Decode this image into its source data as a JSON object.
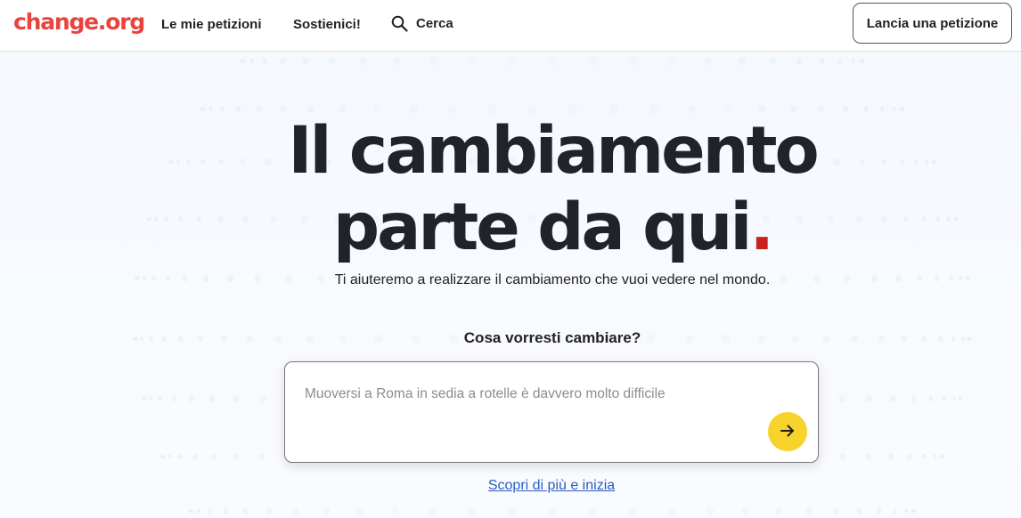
{
  "header": {
    "logo": "change.org",
    "nav": {
      "my_petitions": "Le mie petizioni",
      "support": "Sostienici!",
      "search": "Cerca"
    },
    "launch_button": "Lancia una petizione"
  },
  "hero": {
    "title_line1": "Il cambiamento",
    "title_line2": "parte da qui",
    "title_dot": ".",
    "subtitle": "Ti aiuteremo a realizzare il cambiamento che vuoi vedere nel mondo.",
    "question": "Cosa vorresti cambiare?",
    "input_placeholder": "Muoversi a Roma in sedia a rotelle è davvero molto difficile",
    "learn_more": "Scopri di più e inizia"
  },
  "colors": {
    "brand": "#e8433c",
    "accent_dot": "#c9221c",
    "submit_button": "#f7d32b",
    "link": "#2a5cc3"
  },
  "icons": {
    "search": "search-icon",
    "submit": "arrow-right-icon"
  }
}
